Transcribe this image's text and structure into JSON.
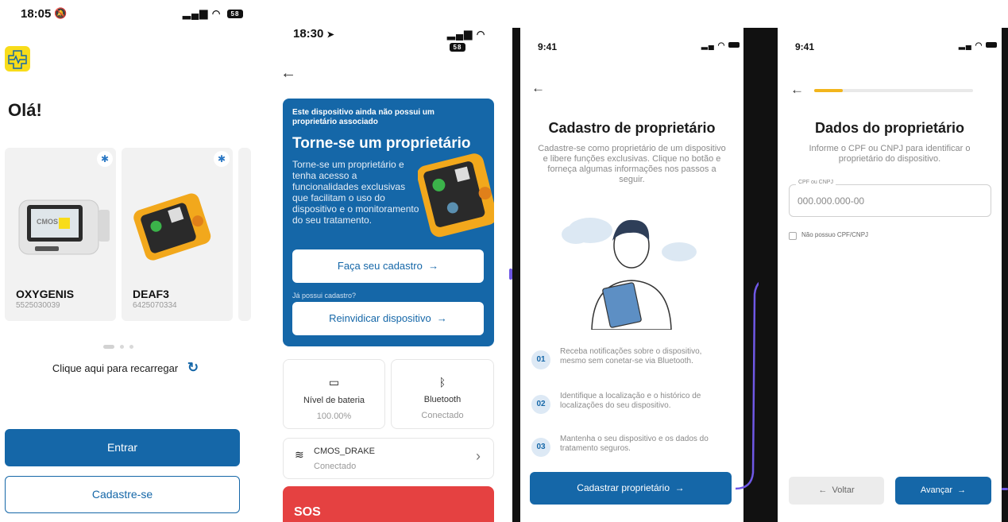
{
  "screen1": {
    "time": "18:05",
    "signal": "▐▐",
    "battery": "58",
    "greeting": "Olá!",
    "devices": [
      {
        "name": "OXYGENIS",
        "serial": "5525030039",
        "screen_text": "CMOS"
      },
      {
        "name": "DEAF3",
        "serial": "6425070334"
      }
    ],
    "reload_text": "Clique aqui para recarregar",
    "reload_icon": "refresh-icon",
    "login_label": "Entrar",
    "signup_label": "Cadastre-se",
    "colors": {
      "primary": "#1567a8",
      "logo": "#f8dc1a"
    }
  },
  "screen2": {
    "time": "18:30",
    "battery": "58",
    "hero_notice": "Este dispositivo ainda não possui um proprietário associado",
    "hero_title": "Torne-se um proprietário",
    "hero_text": "Torne-se um proprietário e tenha acesso a funcionalidades exclusivas que facilitam o uso do dispositivo e o monitoramento do seu tratamento.",
    "signup_btn": "Faça seu cadastro",
    "already_text": "Já possui cadastro?",
    "claim_btn": "Reinvidicar dispositivo",
    "battery_tile": {
      "label": "Nível de bateria",
      "value": "100.00%"
    },
    "bt_tile": {
      "label": "Bluetooth",
      "value": "Conectado"
    },
    "wifi": {
      "name": "CMOS_DRAKE",
      "status": "Conectado"
    },
    "sos": "SOS"
  },
  "screen3": {
    "time": "9:41",
    "title": "Cadastro de proprietário",
    "subtitle": "Cadastre-se como proprietário de um dispositivo e libere funções exclusivas. Clique no botão e forneça algumas informações nos passos a seguir.",
    "steps": [
      {
        "num": "01",
        "text": "Receba notificações sobre o dispositivo, mesmo sem conetar-se via Bluetooth."
      },
      {
        "num": "02",
        "text": "Identifique a localização e o histórico de localizações do seu dispositivo."
      },
      {
        "num": "03",
        "text": "Mantenha o seu dispositivo e os dados do tratamento seguros."
      }
    ],
    "button": "Cadastrar proprietário"
  },
  "screen4": {
    "time": "9:41",
    "title": "Dados do proprietário",
    "subtitle": "Informe o CPF ou CNPJ  para identificar o proprietário do dispositivo.",
    "field_label": "CPF ou CNPJ",
    "field_placeholder": "000.000.000-00",
    "checkbox_label": "Não possuo CPF/CNPJ",
    "back_label": "Voltar",
    "next_label": "Avançar",
    "progress": 0.18
  }
}
